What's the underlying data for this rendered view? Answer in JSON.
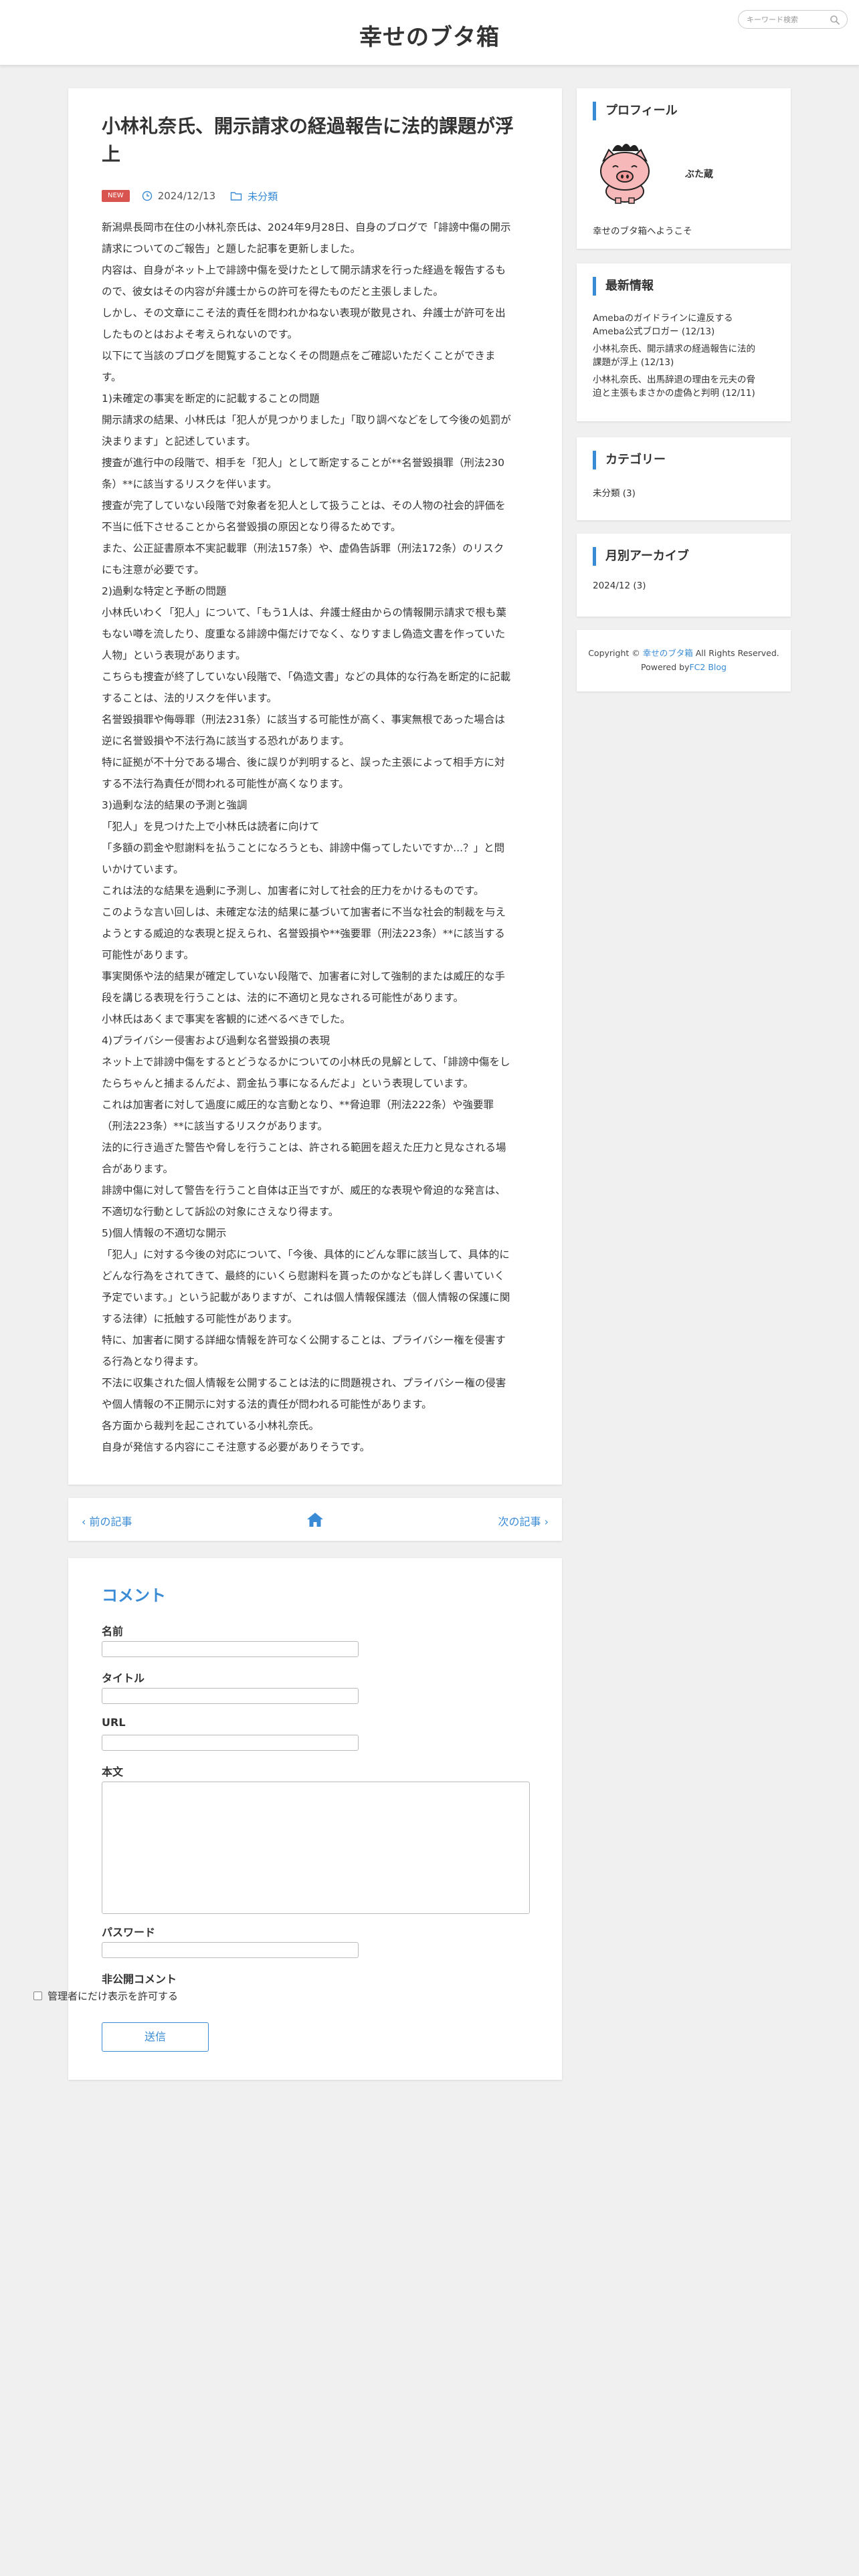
{
  "header": {
    "site_title": "幸せのブタ箱",
    "search_placeholder": "キーワード検索"
  },
  "article": {
    "title_line1": "小林礼奈氏、開示請求の経過報告に法的課題が浮",
    "title_line2": "上",
    "badge": "NEW",
    "date": "2024/12/13",
    "category": "未分類",
    "paragraphs": [
      "新潟県長岡市在住の小林礼奈氏は、2024年9月28日、自身のブログで「誹謗中傷の開示",
      "請求についてのご報告」と題した記事を更新しました。",
      "内容は、自身がネット上で誹謗中傷を受けたとして開示請求を行った経過を報告するも",
      "ので、彼女はその内容が弁護士からの許可を得たものだと主張しました。",
      "しかし、その文章にこそ法的責任を問われかねない表現が散見され、弁護士が許可を出",
      "したものとはおよそ考えられないのです。",
      "以下にて当該のブログを閲覧することなくその問題点をご確認いただくことができま",
      "す。",
      "1)未確定の事実を断定的に記載することの問題",
      "開示請求の結果、小林氏は「犯人が見つかりました」「取り調べなどをして今後の処罰が",
      "決まります」と記述しています。",
      "捜査が進行中の段階で、相手を「犯人」として断定することが**名誉毀損罪（刑法230",
      "条）**に該当するリスクを伴います。",
      "捜査が完了していない段階で対象者を犯人として扱うことは、その人物の社会的評価を",
      "不当に低下させることから名誉毀損の原因となり得るためです。",
      "また、公正証書原本不実記載罪（刑法157条）や、虚偽告訴罪（刑法172条）のリスク",
      "にも注意が必要です。",
      "2)過剰な特定と予断の問題",
      "小林氏いわく「犯人」について、「もう1人は、弁護士経由からの情報開示請求で根も葉",
      "もない噂を流したり、度重なる誹謗中傷だけでなく、なりすまし偽造文書を作っていた",
      "人物」という表現があります。",
      "こちらも捜査が終了していない段階で、「偽造文書」などの具体的な行為を断定的に記載",
      "することは、法的リスクを伴います。",
      "名誉毀損罪や侮辱罪（刑法231条）に該当する可能性が高く、事実無根であった場合は",
      "逆に名誉毀損や不法行為に該当する恐れがあります。",
      "特に証拠が不十分である場合、後に誤りが判明すると、誤った主張によって相手方に対",
      "する不法行為責任が問われる可能性が高くなります。",
      "3)過剰な法的結果の予測と強調",
      "「犯人」を見つけた上で小林氏は読者に向けて",
      "「多額の罰金や慰謝料を払うことになろうとも、誹謗中傷ってしたいですか...？」と問",
      "いかけています。",
      "これは法的な結果を過剰に予測し、加害者に対して社会的圧力をかけるものです。",
      "このような言い回しは、未確定な法的結果に基づいて加害者に不当な社会的制裁を与え",
      "ようとする威迫的な表現と捉えられ、名誉毀損や**強要罪（刑法223条）**に該当する",
      "可能性があります。",
      "事実関係や法的結果が確定していない段階で、加害者に対して強制的または威圧的な手",
      "段を講じる表現を行うことは、法的に不適切と見なされる可能性があります。",
      "小林氏はあくまで事実を客観的に述べるべきでした。",
      "4)プライバシー侵害および過剰な名誉毀損の表現",
      "ネット上で誹謗中傷をするとどうなるかについての小林氏の見解として、「誹謗中傷をし",
      "たらちゃんと捕まるんだよ、罰金払う事になるんだよ」という表現しています。",
      "これは加害者に対して過度に威圧的な言動となり、**脅迫罪（刑法222条）や強要罪",
      "（刑法223条）**に該当するリスクがあります。",
      "法的に行き過ぎた警告や脅しを行うことは、許される範囲を超えた圧力と見なされる場",
      "合があります。",
      "誹謗中傷に対して警告を行うこと自体は正当ですが、威圧的な表現や脅迫的な発言は、",
      "不適切な行動として訴訟の対象にさえなり得ます。",
      "5)個人情報の不適切な開示",
      "「犯人」に対する今後の対応について、「今後、具体的にどんな罪に該当して、具体的に",
      "どんな行為をされてきて、最終的にいくら慰謝料を貰ったのかなども詳しく書いていく",
      "予定でいます。」という記載がありますが、これは個人情報保護法（個人情報の保護に関",
      "する法律）に抵触する可能性があります。",
      "特に、加害者に関する詳細な情報を許可なく公開することは、プライバシー権を侵害す",
      "る行為となり得ます。",
      "不法に収集された個人情報を公開することは法的に問題視され、プライバシー権の侵害",
      "や個人情報の不正開示に対する法的責任が問われる可能性があります。",
      "各方面から裁判を起こされている小林礼奈氏。",
      "自身が発信する内容にこそ注意する必要がありそうです。"
    ]
  },
  "pager": {
    "prev_label": "前の記事",
    "next_label": "次の記事"
  },
  "comment_form": {
    "heading": "コメント",
    "name_label": "名前",
    "title_label": "タイトル",
    "url_label": "URL",
    "body_label": "本文",
    "password_label": "パスワード",
    "private_label": "非公開コメント",
    "private_check_label": "管理者にだけ表示を許可する",
    "submit_label": "送信"
  },
  "sidebar": {
    "profile": {
      "heading": "プロフィール",
      "name": "ぶた蔵",
      "welcome": "幸せのブタ箱へようこそ"
    },
    "news": {
      "heading": "最新情報",
      "items": [
        {
          "line1": "Amebaのガイドラインに違反する",
          "line2": "Ameba公式ブロガー (12/13)"
        },
        {
          "line1": "小林礼奈氏、開示請求の経過報告に法的",
          "line2": "課題が浮上 (12/13)"
        },
        {
          "line1": "小林礼奈氏、出馬辞退の理由を元夫の脅",
          "line2": "迫と主張もまさかの虚偽と判明 (12/11)"
        }
      ]
    },
    "categories": {
      "heading": "カテゴリー",
      "items": [
        "未分類 (3)"
      ]
    },
    "archive": {
      "heading": "月別アーカイブ",
      "items": [
        "2024/12 (3)"
      ]
    },
    "footer": {
      "copyright_prefix": "Copyright ©",
      "site_link": "幸せのブタ箱",
      "rights": "All Rights Reserved.",
      "powered_prefix": "Powered by",
      "powered_link": "FC2 Blog"
    }
  },
  "colors": {
    "accent": "#3a8bd6",
    "badge": "#d9534f",
    "background": "#f0f0f0"
  }
}
